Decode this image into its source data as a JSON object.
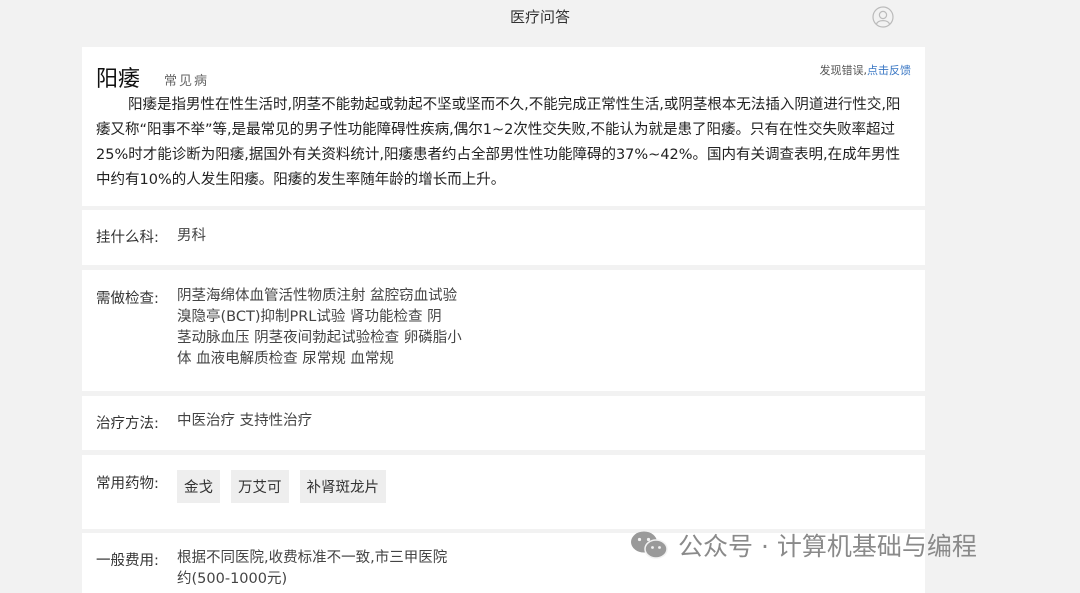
{
  "header": {
    "title": "医疗问答"
  },
  "disease": {
    "name": "阳痿",
    "tag": "常见病",
    "report_prefix": "发现错误,",
    "report_link": "点击反馈",
    "description": "阳痿是指男性在性生活时,阴茎不能勃起或勃起不坚或坚而不久,不能完成正常性生活,或阴茎根本无法插入阴道进行性交,阳痿又称“阳事不举”等,是最常见的男子性功能障碍性疾病,偶尔1~2次性交失败,不能认为就是患了阳痿。只有在性交失败率超过25%时才能诊断为阳痿,据国外有关资料统计,阳痿患者约占全部男性性功能障碍的37%~42%。国内有关调查表明,在成年男性中约有10%的人发生阳痿。阳痿的发生率随年龄的增长而上升。"
  },
  "department": {
    "label": "挂什么科:",
    "value": "男科"
  },
  "exams": {
    "label": "需做检查:",
    "lines": [
      "阴茎海绵体血管活性物质注射 盆腔窃血试验",
      "溴隐亭(BCT)抑制PRL试验 肾功能检查 阴",
      "茎动脉血压 阴茎夜间勃起试验检查 卵磷脂小",
      "体 血液电解质检查 尿常规 血常规"
    ]
  },
  "treatment": {
    "label": "治疗方法:",
    "value": "中医治疗 支持性治疗"
  },
  "drugs": {
    "label": "常用药物:",
    "items": [
      "金戈",
      "万艾可",
      "补肾斑龙片"
    ]
  },
  "cost": {
    "label": "一般费用:",
    "lines": [
      "根据不同医院,收费标准不一致,市三甲医院",
      "约(500-1000元)"
    ]
  },
  "watermark": {
    "text": "公众号 · 计算机基础与编程"
  },
  "icons": {
    "user": "user-icon",
    "wechat": "wechat-icon"
  },
  "colors": {
    "background": "#f2f2f2",
    "card": "#ffffff",
    "link": "#3a77c4",
    "tag_bg": "#eeeeee"
  }
}
